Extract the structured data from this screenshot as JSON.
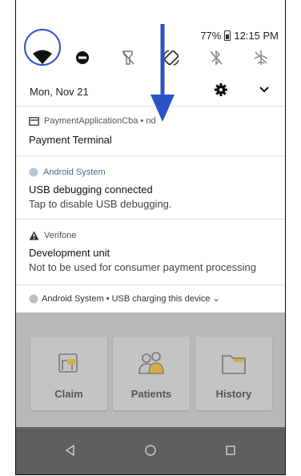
{
  "status": {
    "battery": "77%",
    "time": "12:15 PM"
  },
  "quick_settings": {
    "icons": [
      "wifi-icon",
      "do-not-disturb-icon",
      "flashlight-off-icon",
      "auto-rotate-icon",
      "bluetooth-off-icon",
      "airplane-mode-icon"
    ],
    "date": "Mon, Nov 21"
  },
  "notifications": [
    {
      "app": "PaymentApplicationCba • nd",
      "title": "Payment Terminal",
      "body": ""
    },
    {
      "app": "Android System",
      "title": "USB debugging connected",
      "body": "Tap to disable USB debugging."
    },
    {
      "app": "Verifone",
      "title": "Development unit",
      "body": "Not to be used for consumer payment processing"
    }
  ],
  "summary": {
    "text": "Android System • USB charging this device ⌄"
  },
  "app_tiles": [
    {
      "label": "Claim"
    },
    {
      "label": "Patients"
    },
    {
      "label": "History"
    }
  ],
  "nav": {
    "buttons": [
      "back-icon",
      "home-icon",
      "recents-icon"
    ]
  },
  "colors": {
    "highlight": "#2a53c6",
    "accent_yellow": "#e8c44a"
  }
}
